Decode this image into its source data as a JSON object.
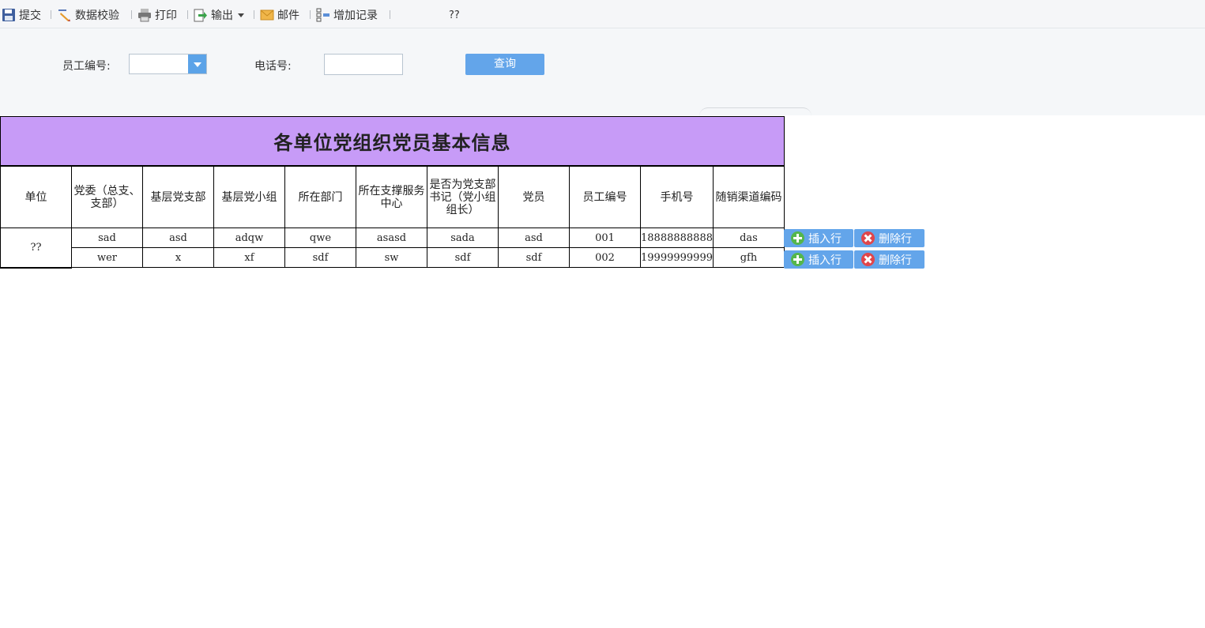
{
  "toolbar": {
    "items": [
      {
        "label": "提交",
        "icon": "save-icon"
      },
      {
        "label": "数据校验",
        "icon": "pencil-check-icon"
      },
      {
        "label": "打印",
        "icon": "printer-icon"
      },
      {
        "label": "输出",
        "icon": "export-icon"
      },
      {
        "label": "邮件",
        "icon": "mail-icon"
      },
      {
        "label": "增加记录",
        "icon": "add-record-icon"
      }
    ],
    "extra_text": "??"
  },
  "query": {
    "employee_id_label": "员工编号:",
    "employee_id_value": "",
    "phone_label": "电话号:",
    "phone_value": "",
    "search_button": "查询"
  },
  "report": {
    "title": "各单位党组织党员基本信息",
    "headers": [
      "单位",
      "党委（总支、支部）",
      "基层党支部",
      "基层党小组",
      "所在部门",
      "所在支撑服务中心",
      "是否为党支部书记（党小组组长）",
      "党员",
      "员工编号",
      "手机号",
      "随销渠道编码"
    ],
    "unit_value": "??",
    "rows": [
      [
        "sad",
        "asd",
        "adqw",
        "qwe",
        "asasd",
        "sada",
        "asd",
        "001",
        "18888888888",
        "das"
      ],
      [
        "wer",
        "x",
        "xf",
        "sdf",
        "sw",
        "sdf",
        "sdf",
        "002",
        "19999999999",
        "gfh"
      ]
    ],
    "insert_label": "插入行",
    "delete_label": "删除行"
  },
  "colors": {
    "title_bg": "#c79bf7",
    "button_bg": "#63a5ea",
    "toolbar_bg": "#f5f6f8"
  }
}
